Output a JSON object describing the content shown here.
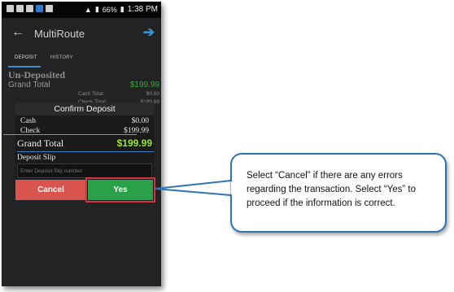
{
  "statusbar": {
    "battery": "66%",
    "time": "1:38 PM"
  },
  "appbar": {
    "title": "MultiRoute",
    "back_icon": "back-arrow-icon",
    "forward_icon": "forward-arrow-icon"
  },
  "tabs": [
    {
      "label": "DEPOSIT"
    },
    {
      "label": "HISTORY"
    }
  ],
  "summary": {
    "heading": "Un-Deposited",
    "grand_total_label": "Grand Total",
    "grand_total_value": "$199.99",
    "cash_total_label": "Cash Total:",
    "cash_total_value": "$0.00",
    "check_total_label": "Check Total:",
    "check_total_value": "$199.99"
  },
  "dialog": {
    "title": "Confirm Deposit",
    "cash_label": "Cash",
    "cash_value": "$0.00",
    "check_label": "Check",
    "check_value": "$199.99",
    "grand_total_label": "Grand Total",
    "grand_total_value": "$199.99",
    "slip_label": "Deposit Slip",
    "slip_placeholder": "Enter Deposit Slip number",
    "cancel_label": "Cancel",
    "yes_label": "Yes"
  },
  "callout": {
    "text": "Select “Cancel” if there are any errors regarding the transaction. Select “Yes” to proceed if the information  is correct."
  },
  "colors": {
    "cancel": "#d9534f",
    "yes": "#28a148",
    "grand_total": "#9be33a",
    "callout_border": "#2e74b5",
    "highlight": "#d0363d"
  }
}
